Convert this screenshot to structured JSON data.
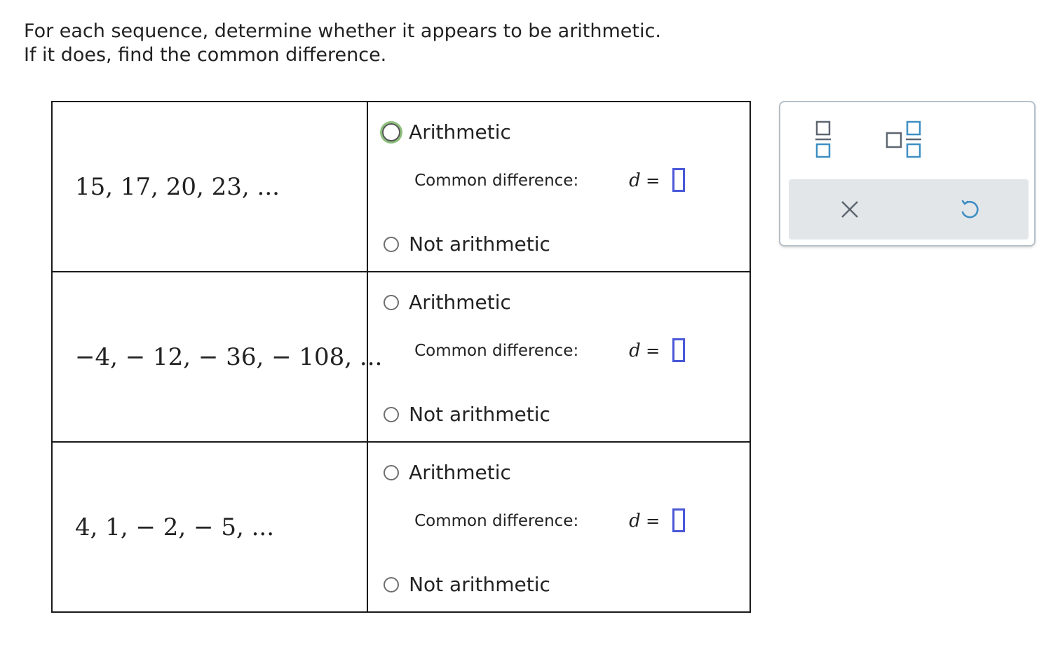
{
  "instructions": {
    "line1": "For each sequence, determine whether it appears to be arithmetic.",
    "line2": "If it does, find the common difference."
  },
  "rows": [
    {
      "sequence": "15, 17, 20, 23, ...",
      "option_arithmetic": "Arithmetic",
      "common_difference_label": "Common difference:",
      "variable": "d",
      "equals": "=",
      "option_not_arithmetic": "Not arithmetic"
    },
    {
      "sequence": "−4, − 12, − 36, − 108, ...",
      "option_arithmetic": "Arithmetic",
      "common_difference_label": "Common difference:",
      "variable": "d",
      "equals": "=",
      "option_not_arithmetic": "Not arithmetic"
    },
    {
      "sequence": "4, 1, − 2, − 5, ...",
      "option_arithmetic": "Arithmetic",
      "common_difference_label": "Common difference:",
      "variable": "d",
      "equals": "=",
      "option_not_arithmetic": "Not arithmetic"
    }
  ],
  "toolbar": {
    "tools": [
      {
        "icon": "fraction-icon"
      },
      {
        "icon": "mixed-number-icon"
      }
    ],
    "actions": [
      {
        "icon": "clear-icon"
      },
      {
        "icon": "undo-icon"
      }
    ]
  },
  "colors": {
    "input_border": "#4a58d8",
    "focus_ring": "#8dc07c",
    "icon_blue": "#3e8fc3",
    "icon_gray": "#5e6670",
    "panel_border": "#b6c0c8",
    "action_bar_bg": "#e2e6e9"
  }
}
